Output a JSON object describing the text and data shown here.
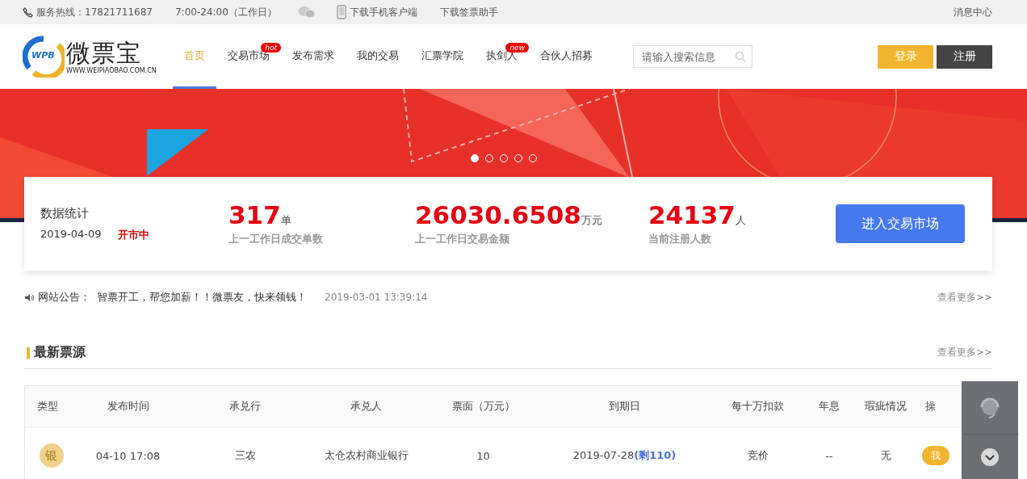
{
  "top_bar": {
    "hotline": "服务热线：17821711687",
    "hours": "7:00-24:00（工作日）",
    "download_app": "下载手机客户端",
    "download_helper": "下载签票助手",
    "messages": "消息中心"
  },
  "logo": {
    "mark": "WPB",
    "name": "微票宝",
    "url": "WWW.WEIPIAOBAO.COM.CN"
  },
  "nav": [
    {
      "label": "首页",
      "selected": true
    },
    {
      "label": "交易市场",
      "selected": false,
      "badge": "hot"
    },
    {
      "label": "发布需求",
      "selected": false
    },
    {
      "label": "我的交易",
      "selected": false
    },
    {
      "label": "汇票学院",
      "selected": false
    },
    {
      "label": "执剑人",
      "selected": false,
      "badge": "new"
    },
    {
      "label": "合伙人招募",
      "selected": false
    }
  ],
  "search": {
    "placeholder": "请输入搜索信息"
  },
  "buttons": {
    "login": "登录",
    "register": "注册"
  },
  "carousel": {
    "dots": [
      {
        "selected": true
      },
      {
        "selected": false
      },
      {
        "selected": false
      },
      {
        "selected": false
      },
      {
        "selected": false
      }
    ]
  },
  "stats": {
    "title": "数据统计",
    "date": "2019-04-09",
    "status": "开市中",
    "items": [
      {
        "value": "317",
        "unit": "单",
        "label": "上一工作日成交单数"
      },
      {
        "value": "26030.6508",
        "unit": "万元",
        "label": "上一工作日交易金额"
      },
      {
        "value": "24137",
        "unit": "人",
        "label": "当前注册人数"
      }
    ],
    "button": "进入交易市场"
  },
  "notice": {
    "label": "网站公告：",
    "text": "智票开工，帮您加薪！！微票友，快来领钱！",
    "time": "2019-03-01 13:39:14",
    "more": "查看更多>>"
  },
  "section": {
    "title": "最新票源",
    "more": "查看更多>>"
  },
  "table": {
    "columns": [
      "类型",
      "发布时间",
      "承兑行",
      "承兑人",
      "票面（万元）",
      "到期日",
      "每十万扣款",
      "年息",
      "瑕疵情况",
      "操"
    ],
    "rows": [
      {
        "type": "银",
        "time": "04-10 17:08",
        "bank": "三农",
        "acceptor": "太仓农村商业银行",
        "amount": "10",
        "due": "2019-07-28",
        "remaining": "(剩110)",
        "discount": "竞价",
        "rate": "--",
        "defects": "无",
        "action": "我"
      }
    ]
  }
}
